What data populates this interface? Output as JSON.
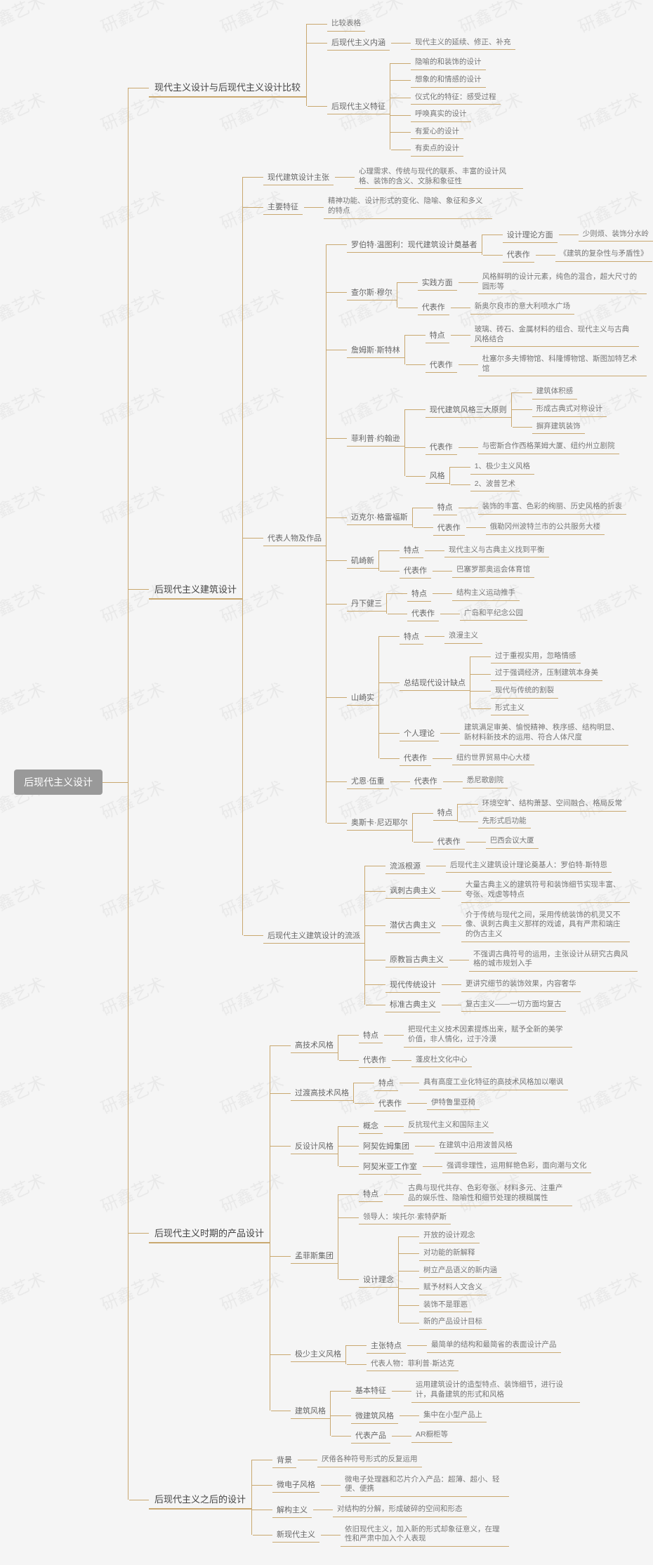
{
  "watermark_text": "研鑫艺术",
  "root": "后现代主义设计",
  "chart_data": {
    "type": "tree",
    "root": "后现代主义设计",
    "children": [
      {
        "label": "现代主义设计与后现代主义设计比较",
        "children": [
          {
            "label": "比较表格"
          },
          {
            "label": "后现代主义内涵",
            "children": [
              {
                "label": "现代主义的延续、修正、补充"
              }
            ]
          },
          {
            "label": "后现代主义特征",
            "children": [
              {
                "label": "隐喻的和装饰的设计"
              },
              {
                "label": "想象的和情感的设计"
              },
              {
                "label": "仪式化的特征：感受过程"
              },
              {
                "label": "呼唤真实的设计"
              },
              {
                "label": "有爱心的设计"
              },
              {
                "label": "有卖点的设计"
              }
            ]
          }
        ]
      },
      {
        "label": "后现代主义建筑设计",
        "children": [
          {
            "label": "现代建筑设计主张",
            "children": [
              {
                "label": "心理需求、传统与现代的联系、丰富的设计风格、装饰的含义、文脉和象征性"
              }
            ]
          },
          {
            "label": "主要特征",
            "children": [
              {
                "label": "精神功能、设计形式的变化、隐喻、象征和多义的特点"
              }
            ]
          },
          {
            "label": "代表人物及作品",
            "children": [
              {
                "label": "罗伯特·温图利：现代建筑设计奠基者",
                "children": [
                  {
                    "label": "设计理论方面",
                    "children": [
                      {
                        "label": "少则烦、装饰分水岭"
                      }
                    ]
                  },
                  {
                    "label": "代表作",
                    "children": [
                      {
                        "label": "《建筑的复杂性与矛盾性》"
                      }
                    ]
                  }
                ]
              },
              {
                "label": "查尔斯·穆尔",
                "children": [
                  {
                    "label": "实践方面",
                    "children": [
                      {
                        "label": "风格鲜明的设计元素，纯色的混合，超大尺寸的圆形等"
                      }
                    ]
                  },
                  {
                    "label": "代表作",
                    "children": [
                      {
                        "label": "新奥尔良市的意大利喷水广场"
                      }
                    ]
                  }
                ]
              },
              {
                "label": "詹姆斯·斯特林",
                "children": [
                  {
                    "label": "特点",
                    "children": [
                      {
                        "label": "玻璃、砖石、金属材料的组合、现代主义与古典风格结合"
                      }
                    ]
                  },
                  {
                    "label": "代表作",
                    "children": [
                      {
                        "label": "杜塞尔多夫博物馆、科隆博物馆、斯图加特艺术馆"
                      }
                    ]
                  }
                ]
              },
              {
                "label": "菲利普·约翰逊",
                "children": [
                  {
                    "label": "现代建筑风格三大原则",
                    "children": [
                      {
                        "label": "建筑体积感"
                      },
                      {
                        "label": "形成古典式对称设计"
                      },
                      {
                        "label": "摒弃建筑装饰"
                      }
                    ]
                  },
                  {
                    "label": "代表作",
                    "children": [
                      {
                        "label": "与密斯合作西格莱姆大厦、纽约州立剧院"
                      }
                    ]
                  },
                  {
                    "label": "风格",
                    "children": [
                      {
                        "label": "1、极少主义风格"
                      },
                      {
                        "label": "2、波普艺术"
                      }
                    ]
                  }
                ]
              },
              {
                "label": "迈克尔·格雷福斯",
                "children": [
                  {
                    "label": "特点",
                    "children": [
                      {
                        "label": "装饰的丰富、色彩的绚丽、历史风格的折衷"
                      }
                    ]
                  },
                  {
                    "label": "代表作",
                    "children": [
                      {
                        "label": "俄勒冈州波特兰市的公共服务大楼"
                      }
                    ]
                  }
                ]
              },
              {
                "label": "矶崎新",
                "children": [
                  {
                    "label": "特点",
                    "children": [
                      {
                        "label": "现代主义与古典主义找到平衡"
                      }
                    ]
                  },
                  {
                    "label": "代表作",
                    "children": [
                      {
                        "label": "巴塞罗那奥运会体育馆"
                      }
                    ]
                  }
                ]
              },
              {
                "label": "丹下健三",
                "children": [
                  {
                    "label": "特点",
                    "children": [
                      {
                        "label": "结构主义运动推手"
                      }
                    ]
                  },
                  {
                    "label": "代表作",
                    "children": [
                      {
                        "label": "广岛和平纪念公园"
                      }
                    ]
                  }
                ]
              },
              {
                "label": "山崎实",
                "children": [
                  {
                    "label": "特点",
                    "children": [
                      {
                        "label": "浪漫主义"
                      }
                    ]
                  },
                  {
                    "label": "总结现代设计缺点",
                    "children": [
                      {
                        "label": "过于重视实用，忽略情感"
                      },
                      {
                        "label": "过于强调经济，压制建筑本身美"
                      },
                      {
                        "label": "现代与传统的割裂"
                      },
                      {
                        "label": "形式主义"
                      }
                    ]
                  },
                  {
                    "label": "个人理论",
                    "children": [
                      {
                        "label": "建筑满足审美、愉悦精神、秩序感、结构明显、新材料新技术的运用、符合人体尺度"
                      }
                    ]
                  },
                  {
                    "label": "代表作",
                    "children": [
                      {
                        "label": "纽约世界贸易中心大楼"
                      }
                    ]
                  }
                ]
              },
              {
                "label": "尤恩·伍重",
                "children": [
                  {
                    "label": "代表作",
                    "children": [
                      {
                        "label": "悉尼歌剧院"
                      }
                    ]
                  }
                ]
              },
              {
                "label": "奥斯卡·尼迈耶尔",
                "children": [
                  {
                    "label": "特点",
                    "children": [
                      {
                        "label": "环境空旷、结构萧瑟、空间融合、格局反常"
                      },
                      {
                        "label": "先形式后功能"
                      }
                    ]
                  },
                  {
                    "label": "代表作",
                    "children": [
                      {
                        "label": "巴西会议大厦"
                      }
                    ]
                  }
                ]
              }
            ]
          },
          {
            "label": "后现代主义建筑设计的流派",
            "children": [
              {
                "label": "流派根源",
                "children": [
                  {
                    "label": "后现代主义建筑设计理论奠基人：罗伯特·斯特恩"
                  }
                ]
              },
              {
                "label": "讽刺古典主义",
                "children": [
                  {
                    "label": "大量古典主义的建筑符号和装饰细节实现丰富、夸张、戏虐等特点"
                  }
                ]
              },
              {
                "label": "潜伏古典主义",
                "children": [
                  {
                    "label": "介于传统与现代之间，采用传统装饰的机灵又不像、讽刺古典主义那样的戏谑，具有严肃和端庄的伪古主义"
                  }
                ]
              },
              {
                "label": "原教旨古典主义",
                "children": [
                  {
                    "label": "不强调古典符号的运用，主张设计从研究古典风格的城市规划入手"
                  }
                ]
              },
              {
                "label": "现代传统设计",
                "children": [
                  {
                    "label": "更讲究细节的装饰效果，内容奢华"
                  }
                ]
              },
              {
                "label": "标准古典主义",
                "children": [
                  {
                    "label": "复古主义——一切方面均复古"
                  }
                ]
              }
            ]
          }
        ]
      },
      {
        "label": "后现代主义时期的产品设计",
        "children": [
          {
            "label": "高技术风格",
            "children": [
              {
                "label": "特点",
                "children": [
                  {
                    "label": "把现代主义技术因素提炼出来，赋予全新的美学价值，非人情化，过于冷漠"
                  }
                ]
              },
              {
                "label": "代表作",
                "children": [
                  {
                    "label": "蓬皮杜文化中心"
                  }
                ]
              }
            ]
          },
          {
            "label": "过渡高技术风格",
            "children": [
              {
                "label": "特点",
                "children": [
                  {
                    "label": "具有高度工业化特征的高技术风格加以嘲讽"
                  }
                ]
              },
              {
                "label": "代表作",
                "children": [
                  {
                    "label": "伊特鲁里亚椅"
                  }
                ]
              }
            ]
          },
          {
            "label": "反设计风格",
            "children": [
              {
                "label": "概念",
                "children": [
                  {
                    "label": "反抗现代主义和国际主义"
                  }
                ]
              },
              {
                "label": "阿契佐姆集团",
                "children": [
                  {
                    "label": "在建筑中沿用波普风格"
                  }
                ]
              },
              {
                "label": "阿契米亚工作室",
                "children": [
                  {
                    "label": "强调非理性，运用鲜艳色彩，面向潮与文化"
                  }
                ]
              }
            ]
          },
          {
            "label": "孟菲斯集团",
            "children": [
              {
                "label": "特点",
                "children": [
                  {
                    "label": "古典与现代共存、色彩夸张、材料多元、注重产品的娱乐性、隐喻性和细节处理的模糊属性"
                  }
                ]
              },
              {
                "label": "领导人：埃托尔·索特萨斯"
              },
              {
                "label": "设计理念",
                "children": [
                  {
                    "label": "开放的设计观念"
                  },
                  {
                    "label": "对功能的新解释"
                  },
                  {
                    "label": "树立产品语义的新内涵"
                  },
                  {
                    "label": "赋予材料人文含义"
                  },
                  {
                    "label": "装饰不是罪恶"
                  },
                  {
                    "label": "新的产品设计目标"
                  }
                ]
              }
            ]
          },
          {
            "label": "极少主义风格",
            "children": [
              {
                "label": "主张特点",
                "children": [
                  {
                    "label": "最简单的结构和最简省的表面设计产品"
                  }
                ]
              },
              {
                "label": "代表人物：菲利普·斯达克"
              }
            ]
          },
          {
            "label": "建筑风格",
            "children": [
              {
                "label": "基本特征",
                "children": [
                  {
                    "label": "运用建筑设计的造型特点、装饰细节，进行设计，具备建筑的形式和风格"
                  }
                ]
              },
              {
                "label": "微建筑风格",
                "children": [
                  {
                    "label": "集中在小型产品上"
                  }
                ]
              },
              {
                "label": "代表产品",
                "children": [
                  {
                    "label": "AR橱柜等"
                  }
                ]
              }
            ]
          }
        ]
      },
      {
        "label": "后现代主义之后的设计",
        "children": [
          {
            "label": "背景",
            "children": [
              {
                "label": "厌倦各种符号形式的反复运用"
              }
            ]
          },
          {
            "label": "微电子风格",
            "children": [
              {
                "label": "微电子处理器和芯片介入产品：超薄、超小、轻便、便携"
              }
            ]
          },
          {
            "label": "解构主义",
            "children": [
              {
                "label": "对结构的分解，形成破碎的空间和形态"
              }
            ]
          },
          {
            "label": "新现代主义",
            "children": [
              {
                "label": "依旧现代主义，加入新的形式却象征意义，在理性和严肃中加入个人表现"
              }
            ]
          }
        ]
      }
    ]
  }
}
